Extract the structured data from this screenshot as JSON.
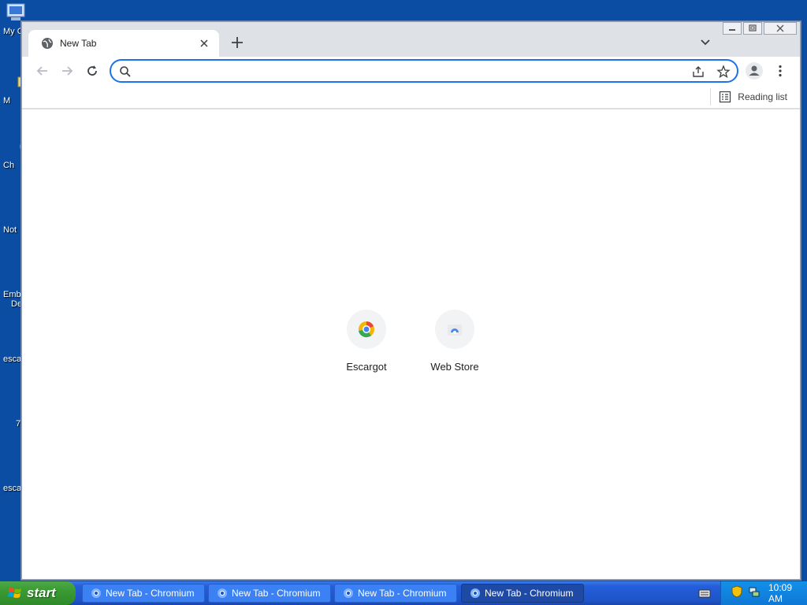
{
  "desktop": {
    "icons": [
      {
        "label": "My C"
      },
      {
        "label": "M"
      },
      {
        "label": "Ch"
      },
      {
        "label": "Not"
      },
      {
        "label": "Emb"
      },
      {
        "label": "De"
      },
      {
        "label": "esca"
      },
      {
        "label": "7"
      },
      {
        "label": "esca"
      }
    ]
  },
  "browser": {
    "tab": {
      "title": "New Tab"
    },
    "omnibox": {
      "value": "",
      "placeholder": ""
    },
    "bookmarks": {
      "reading_list": "Reading list"
    },
    "shortcuts": [
      {
        "label": "Escargot"
      },
      {
        "label": "Web Store"
      }
    ]
  },
  "taskbar": {
    "start_label": "start",
    "tasks": [
      {
        "label": "New Tab - Chromium"
      },
      {
        "label": "New Tab - Chromium"
      },
      {
        "label": "New Tab - Chromium"
      },
      {
        "label": "New Tab - Chromium"
      }
    ],
    "clock": "10:09 AM"
  },
  "colors": {
    "desktop": "#0a4da3",
    "accent": "#1a73e8",
    "taskbar": "#245edb",
    "start": "#3a9a33"
  }
}
